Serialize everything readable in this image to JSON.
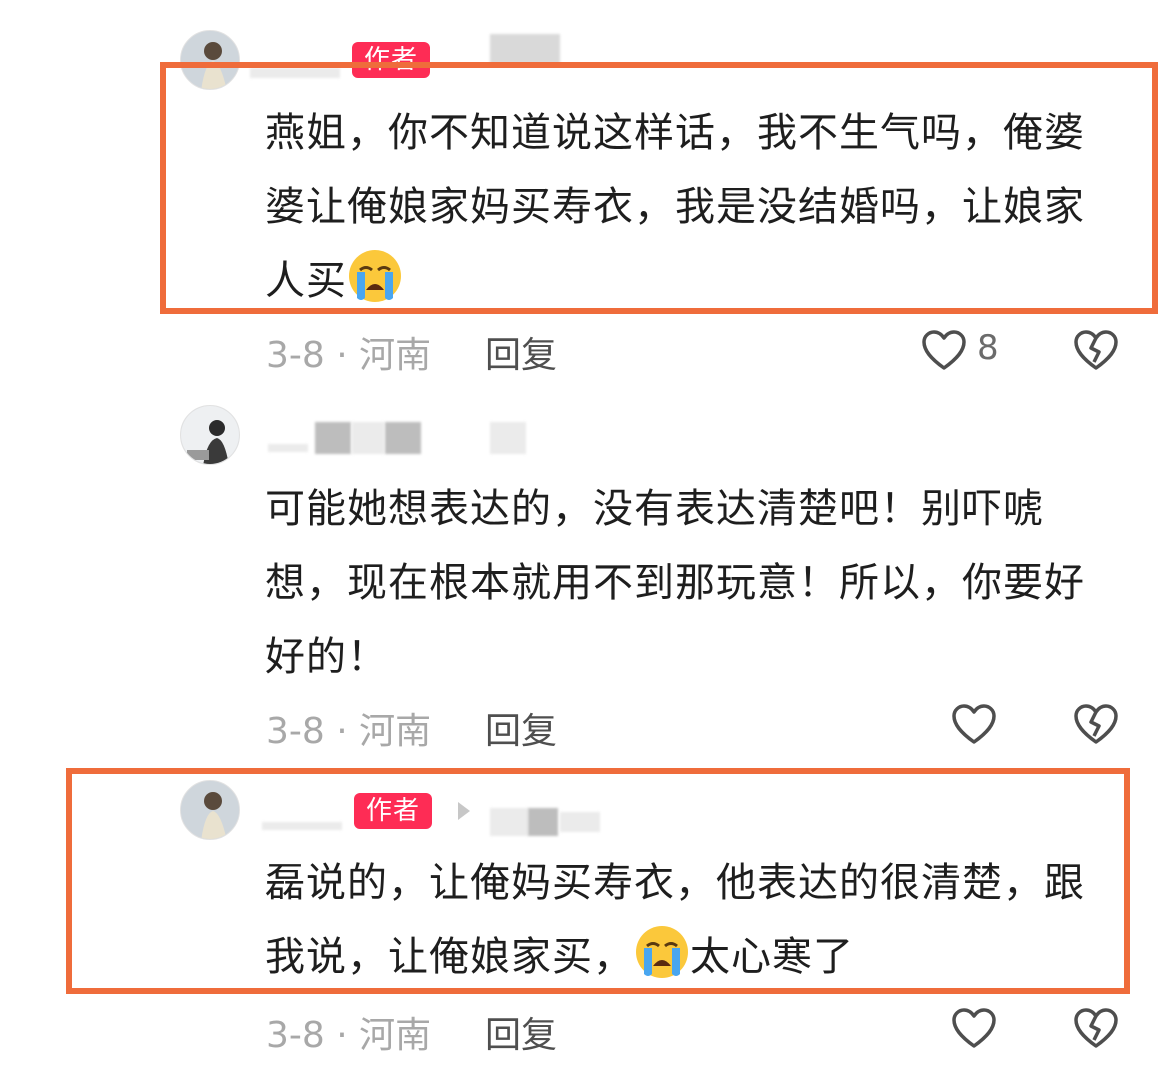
{
  "colors": {
    "author_badge": "#fe2c55",
    "highlight_border": "#ef6c3b",
    "meta_text": "#a8a8a8",
    "reply_text": "#4f4f4f"
  },
  "comments": [
    {
      "author_badge": "作者",
      "text": "燕姐，你不知道说这样话，我不生气吗，俺婆婆让俺娘家妈买寿衣，我是没结婚吗，让娘家人买",
      "emoji": "loudly-crying-face",
      "date_location": "3-8 · 河南",
      "reply_label": "回复",
      "like_count": "8",
      "highlighted": true
    },
    {
      "text": "可能她想表达的，没有表达清楚吧！别吓唬想，现在根本就用不到那玩意！所以，你要好好的！",
      "date_location": "3-8 · 河南",
      "reply_label": "回复",
      "highlighted": false
    },
    {
      "author_badge": "作者",
      "text_before_emoji": "磊说的，让俺妈买寿衣，他表达的很清楚，跟我说，让俺娘家买，",
      "emoji": "loudly-crying-face",
      "text_after_emoji": "太心寒了",
      "date_location": "3-8 · 河南",
      "reply_label": "回复",
      "highlighted": true
    }
  ]
}
